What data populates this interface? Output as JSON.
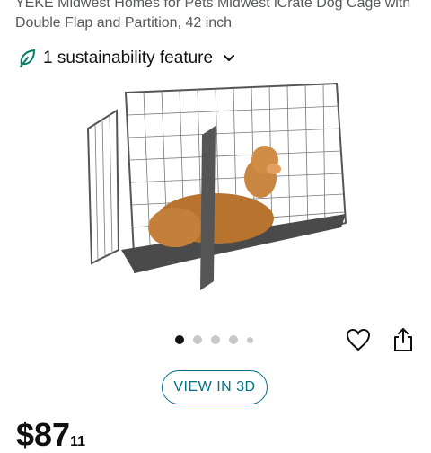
{
  "product": {
    "title": "YEKE Midwest Homes for Pets Midwest iCrate Dog Cage with Double Flap and Partition, 42 inch"
  },
  "sustainability": {
    "label": "1 sustainability feature",
    "icon": "leaf-icon",
    "accent": "#067d62"
  },
  "gallery": {
    "image_alt": "Black wire dog crate with a golden retriever lying inside",
    "dot_count": 5,
    "active_index": 0
  },
  "actions": {
    "favorite_icon": "heart-icon",
    "share_icon": "share-icon"
  },
  "view3d": {
    "label": "VIEW IN 3D",
    "color": "#007185"
  },
  "price": {
    "whole": "$87",
    "fraction": "11"
  }
}
